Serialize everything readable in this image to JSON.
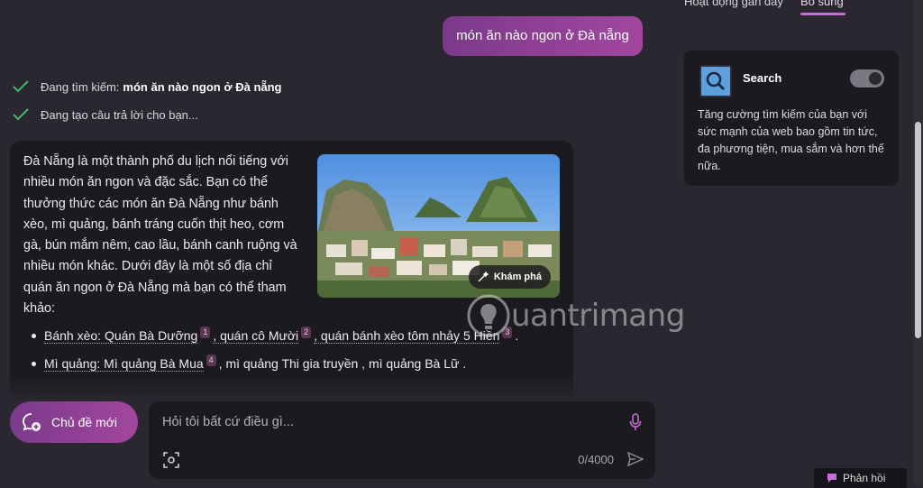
{
  "tabs": [
    {
      "label": "Hoạt động gần đây"
    },
    {
      "label": "Bổ sung"
    }
  ],
  "user_message": "món ăn nào ngon ở Đà nẵng",
  "progress": [
    {
      "text": "Đang tìm kiếm:",
      "query": "món ăn nào ngon ở Đà nẵng"
    },
    {
      "text": "Đang tạo câu trả lời cho bạn..."
    }
  ],
  "answer": {
    "paragraph": "Đà Nẵng là một thành phố du lịch nổi tiếng với nhiều món ăn ngon và đặc sắc. Bạn có thể thưởng thức các món ăn Đà Nẵng như bánh xèo, mì quảng, bánh tráng cuốn thịt heo, cơm gà, bún mắm nêm, cao lầu, bánh canh ruộng và nhiều món khác. Dưới đây là một số địa chỉ quán ăn ngon ở Đà Nẵng mà bạn có thể tham khảo:",
    "explore_label": "Khám phá",
    "bullets": [
      {
        "parts": [
          {
            "text": "Bánh xèo: Quán Bà Dưỡng",
            "cite": "1"
          },
          {
            "text": ", quán cô Mười",
            "cite": "2"
          },
          {
            "text": ", quán bánh xèo tôm nhảy 5 Hiền",
            "cite": "3"
          },
          {
            "text": "."
          }
        ]
      },
      {
        "parts": [
          {
            "text": "Mì quảng: Mì quảng Bà Mua",
            "cite": "4"
          },
          {
            "text": ", mì quảng Thi gia truyền , mì quảng Bà Lữ ."
          }
        ]
      }
    ]
  },
  "new_topic_label": "Chủ đề mới",
  "input": {
    "placeholder": "Hỏi tôi bất cứ điều gì...",
    "counter": "0/4000"
  },
  "plugin": {
    "name": "Search",
    "enabled": true,
    "description": "Tăng cường tìm kiếm của bạn với sức mạnh của web bao gồm tin tức, đa phương tiện, mua sắm và hơn thế nữa."
  },
  "feedback_label": "Phản hồi",
  "watermark": "uantrimang",
  "colors": {
    "accent": "#a2469e",
    "background": "#2a2730",
    "card": "#1b1a1e"
  },
  "icons": [
    "check-icon",
    "sparkle-icon",
    "new-chat-icon",
    "image-scan-icon",
    "microphone-icon",
    "send-icon",
    "search-icon",
    "feedback-icon"
  ]
}
